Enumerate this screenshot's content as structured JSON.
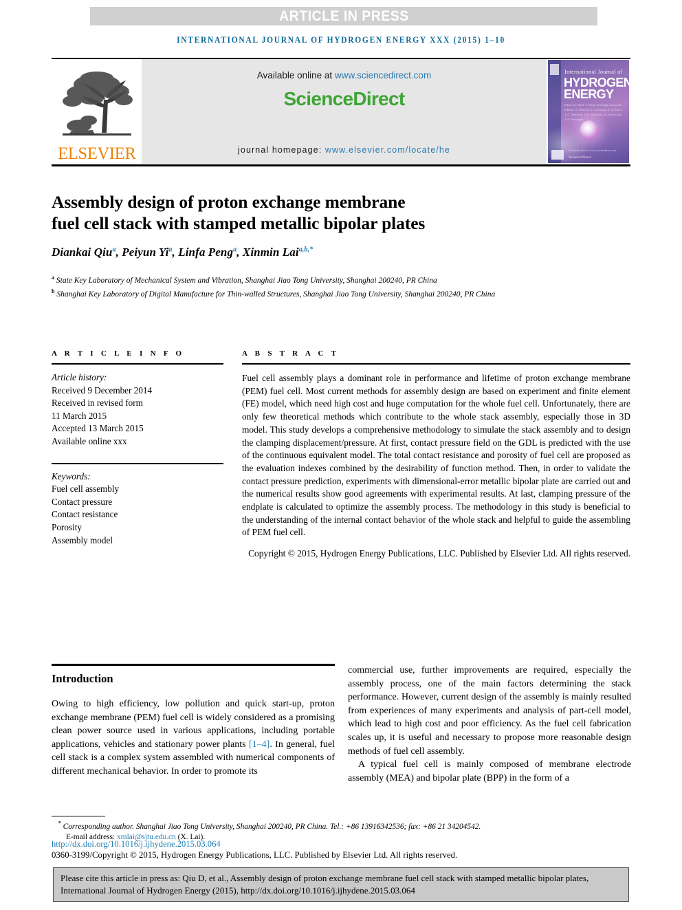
{
  "banner": {
    "label": "ARTICLE IN PRESS"
  },
  "running_head": "INTERNATIONAL JOURNAL OF HYDROGEN ENERGY XXX (2015) 1–10",
  "masthead": {
    "publisher": "ELSEVIER",
    "available_prefix": "Available online at ",
    "available_url": "www.sciencedirect.com",
    "sciencedirect_science": "Science",
    "sciencedirect_direct": "Direct",
    "homepage_prefix": "journal homepage: ",
    "homepage_url": "www.elsevier.com/locate/he",
    "cover": {
      "line_small": "International Journal of",
      "line_big1": "HYDROGEN",
      "line_big2": "ENERGY",
      "editors": "Editor-in-Chief: T. Nejat Veziroğlu\nAssociate Editors: S. Dutta, D.Y. Goswami, A. A. Evers, A.C. Marsden, J.W. Sheffield, I.E. Ersoy and T.A. Aminaglu",
      "footer_note": "Available online at www.sciencedirect.com",
      "footer_brand": "ScienceDirect"
    }
  },
  "article": {
    "title_line1": "Assembly design of proton exchange membrane",
    "title_line2": "fuel cell stack with stamped metallic bipolar plates",
    "authors": [
      {
        "name": "Diankai Qiu",
        "sup": "a"
      },
      {
        "name": "Peiyun Yi",
        "sup": "a"
      },
      {
        "name": "Linfa Peng",
        "sup": "a"
      },
      {
        "name": "Xinmin Lai",
        "sup": "a,b,*"
      }
    ],
    "affiliations": [
      {
        "marker": "a",
        "text": "State Key Laboratory of Mechanical System and Vibration, Shanghai Jiao Tong University, Shanghai 200240, PR China"
      },
      {
        "marker": "b",
        "text": "Shanghai Key Laboratory of Digital Manufacture for Thin-walled Structures, Shanghai Jiao Tong University, Shanghai 200240, PR China"
      }
    ]
  },
  "info": {
    "section_label": "A R T I C L E   I N F O",
    "history_label": "Article history:",
    "history": [
      "Received 9 December 2014",
      "Received in revised form",
      "11 March 2015",
      "Accepted 13 March 2015",
      "Available online xxx"
    ],
    "keywords_label": "Keywords:",
    "keywords": [
      "Fuel cell assembly",
      "Contact pressure",
      "Contact resistance",
      "Porosity",
      "Assembly model"
    ]
  },
  "abstract": {
    "section_label": "A B S T R A C T",
    "text": "Fuel cell assembly plays a dominant role in performance and lifetime of proton exchange membrane (PEM) fuel cell. Most current methods for assembly design are based on experiment and finite element (FE) model, which need high cost and huge computation for the whole fuel cell. Unfortunately, there are only few theoretical methods which contribute to the whole stack assembly, especially those in 3D model. This study develops a comprehensive methodology to simulate the stack assembly and to design the clamping displacement/pressure. At first, contact pressure field on the GDL is predicted with the use of the continuous equivalent model. The total contact resistance and porosity of fuel cell are proposed as the evaluation indexes combined by the desirability of function method. Then, in order to validate the contact pressure prediction, experiments with dimensional-error metallic bipolar plate are carried out and the numerical results show good agreements with experimental results. At last, clamping pressure of the endplate is calculated to optimize the assembly process. The methodology in this study is beneficial to the understanding of the internal contact behavior of the whole stack and helpful to guide the assembling of PEM fuel cell.",
    "copyright": "Copyright © 2015, Hydrogen Energy Publications, LLC. Published by Elsevier Ltd. All rights reserved."
  },
  "introduction": {
    "heading": "Introduction",
    "left_part1": "Owing to high efficiency, low pollution and quick start-up, proton exchange membrane (PEM) fuel cell is widely considered as a promising clean power source used in various applications, including portable applications, vehicles and stationary power plants ",
    "left_ref": "[1–4]",
    "left_part2": ". In general, fuel cell stack is a complex system assembled with numerical components of different mechanical behavior. In order to promote its",
    "right_para1": "commercial use, further improvements are required, especially the assembly process, one of the main factors determining the stack performance. However, current design of the assembly is mainly resulted from experiences of many experiments and analysis of part-cell model, which lead to high cost and poor efficiency. As the fuel cell fabrication scales up, it is useful and necessary to propose more reasonable design methods of fuel cell assembly.",
    "right_para2": "A typical fuel cell is mainly composed of membrane electrode assembly (MEA) and bipolar plate (BPP) in the form of a"
  },
  "footer": {
    "corresponding_marker": "*",
    "corresponding_text": "Corresponding author. Shanghai Jiao Tong University, Shanghai 200240, PR China. Tel.: +86 13916342536; fax: +86 21 34204542.",
    "email_label": "E-mail address: ",
    "email": "xmlai@sjtu.edu.cn",
    "email_suffix": " (X. Lai).",
    "doi": "http://dx.doi.org/10.1016/j.ijhydene.2015.03.064",
    "issn_copyright": "0360-3199/Copyright © 2015, Hydrogen Energy Publications, LLC. Published by Elsevier Ltd. All rights reserved."
  },
  "cite_box": {
    "text": "Please cite this article in press as: Qiu D, et al., Assembly design of proton exchange membrane fuel cell stack with stamped metallic bipolar plates, International Journal of Hydrogen Energy (2015), http://dx.doi.org/10.1016/j.ijhydene.2015.03.064"
  },
  "colors": {
    "link": "#1f7fb5",
    "running_head": "#0b6a9b",
    "elsevier_orange": "#f08000",
    "sciencedirect_green": "#3fa535",
    "banner_bg": "#d0d0d0",
    "masthead_bg": "#e6e6e6",
    "cite_box_bg": "#c9c9c9"
  }
}
